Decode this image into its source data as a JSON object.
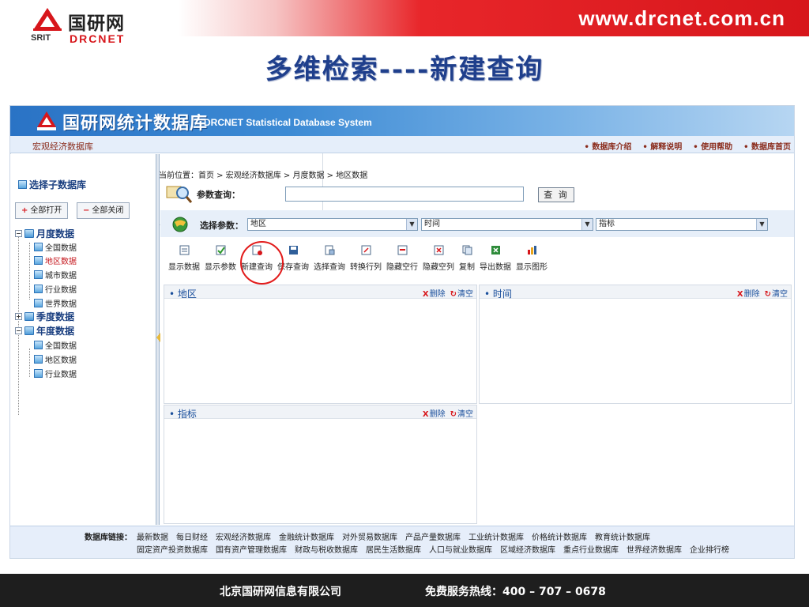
{
  "slide": {
    "logo_cn": "国研网",
    "logo_en_left": "SRIT",
    "logo_en_right": "DRCNET",
    "site_url": "www.drcnet.com.cn",
    "title": "多维检索----新建查询"
  },
  "app": {
    "title_cn": "国研网统计数据库",
    "title_en": "DRCNET Statistical Database System",
    "module": "宏观经济数据库",
    "top_links": [
      "数据库介绍",
      "解释说明",
      "使用帮助",
      "数据库首页"
    ]
  },
  "sidebar": {
    "select_db": "选择子数据库",
    "expand_all": "全部打开",
    "collapse_all": "全部关闭",
    "tree": [
      {
        "label": "月度数据",
        "children": [
          "全国数据",
          "地区数据",
          "城市数据",
          "行业数据",
          "世界数据"
        ],
        "selected_child": "地区数据"
      },
      {
        "label": "季度数据",
        "children": []
      },
      {
        "label": "年度数据",
        "children": [
          "全国数据",
          "地区数据",
          "行业数据"
        ]
      }
    ]
  },
  "main": {
    "breadcrumb": "当前位置：首页 > 宏观经济数据库 > 月度数据 > 地区数据",
    "param_query_label": "参数查询：",
    "param_query_value": "",
    "search_button": "查 询",
    "select_params_label": "选择参数：",
    "dropdowns": {
      "region": "地区",
      "time": "时间",
      "indicator": "指标"
    },
    "toolbar": [
      "显示数据",
      "显示参数",
      "新建查询",
      "保存查询",
      "选择查询",
      "转换行列",
      "隐藏空行",
      "隐藏空列",
      "复制",
      "导出数据",
      "显示图形"
    ],
    "highlighted_tool": "新建查询",
    "panels": {
      "region": "地区",
      "time": "时间",
      "indicator": "指标",
      "delete": "删除",
      "clear": "清空"
    }
  },
  "footer_links": {
    "label": "数据库链接：",
    "row1": [
      "最新数据",
      "每日财经",
      "宏观经济数据库",
      "金融统计数据库",
      "对外贸易数据库",
      "产品产量数据库",
      "工业统计数据库",
      "价格统计数据库",
      "教育统计数据库"
    ],
    "row2": [
      "固定资产投资数据库",
      "国有资产管理数据库",
      "财政与税收数据库",
      "居民生活数据库",
      "人口与就业数据库",
      "区域经济数据库",
      "重点行业数据库",
      "世界经济数据库",
      "企业排行榜"
    ]
  },
  "slide_footer": {
    "company": "北京国研网信息有限公司",
    "hotline": "免费服务热线：400 – 707 – 0678"
  },
  "colors": {
    "brand_red": "#d7161b",
    "title_blue": "#1f3f8c",
    "banner_blue": "#2a73c5"
  }
}
